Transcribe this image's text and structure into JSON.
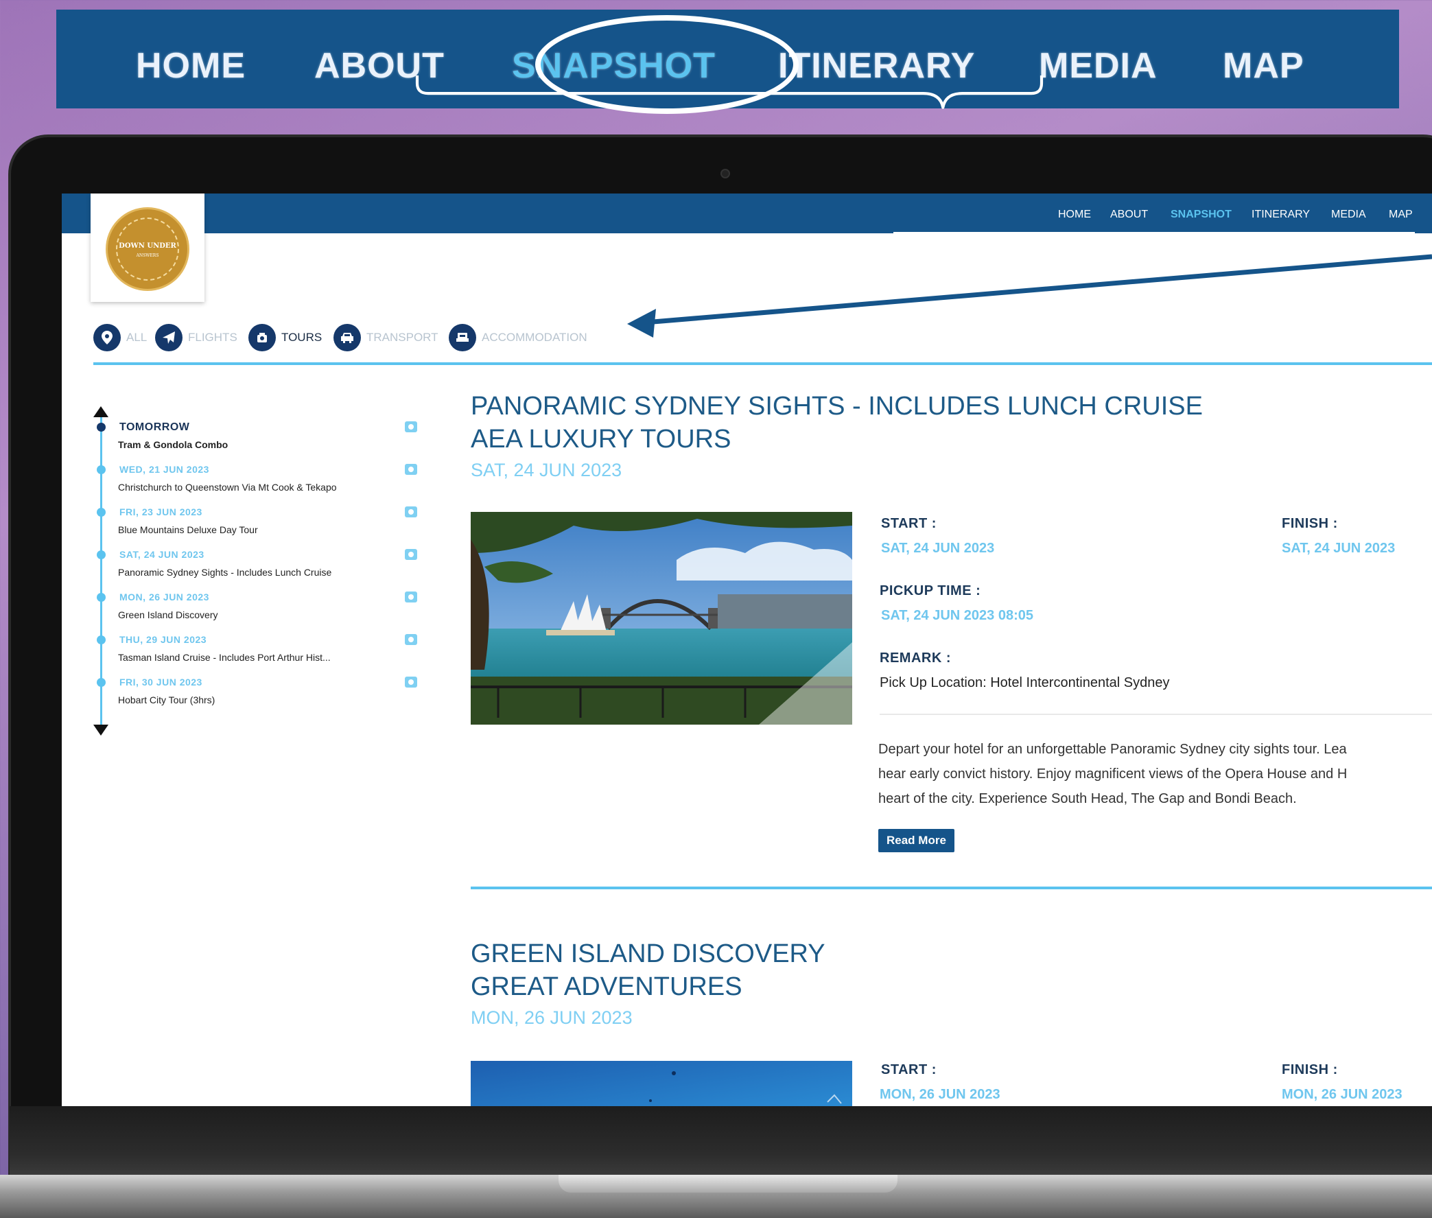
{
  "promo_nav": {
    "items": [
      {
        "label": "HOME"
      },
      {
        "label": "ABOUT"
      },
      {
        "label": "SNAPSHOT"
      },
      {
        "label": "ITINERARY"
      },
      {
        "label": "MEDIA"
      },
      {
        "label": "MAP"
      }
    ],
    "active_index": 2
  },
  "site_nav": {
    "items": [
      {
        "label": "HOME"
      },
      {
        "label": "ABOUT"
      },
      {
        "label": "SNAPSHOT"
      },
      {
        "label": "ITINERARY"
      },
      {
        "label": "MEDIA"
      },
      {
        "label": "MAP"
      }
    ],
    "active_index": 2
  },
  "logo": {
    "text": "DOWN UNDER",
    "sub": "ANSWERS"
  },
  "filters": [
    {
      "label": "ALL",
      "icon": "map-pin-icon",
      "active": false
    },
    {
      "label": "FLIGHTS",
      "icon": "plane-icon",
      "active": false
    },
    {
      "label": "TOURS",
      "icon": "tours-icon",
      "active": true
    },
    {
      "label": "TRANSPORT",
      "icon": "car-icon",
      "active": false
    },
    {
      "label": "ACCOMMODATION",
      "icon": "bed-icon",
      "active": false
    }
  ],
  "timeline": [
    {
      "date": "TOMORROW",
      "title": "Tram & Gondola Combo",
      "current": true
    },
    {
      "date": "WED, 21 JUN 2023",
      "title": "Christchurch to Queenstown Via Mt Cook & Tekapo",
      "current": false
    },
    {
      "date": "FRI, 23 JUN 2023",
      "title": "Blue Mountains Deluxe Day Tour",
      "current": false
    },
    {
      "date": "SAT, 24 JUN 2023",
      "title": "Panoramic Sydney Sights - Includes Lunch Cruise",
      "current": false
    },
    {
      "date": "MON, 26 JUN 2023",
      "title": "Green Island Discovery",
      "current": false
    },
    {
      "date": "THU, 29 JUN 2023",
      "title": "Tasman Island Cruise - Includes Port Arthur Hist...",
      "current": false
    },
    {
      "date": "FRI, 30 JUN 2023",
      "title": "Hobart City Tour (3hrs)",
      "current": false
    }
  ],
  "tours": [
    {
      "title": "PANORAMIC SYDNEY SIGHTS - INCLUDES LUNCH CRUISE",
      "operator": "AEA LUXURY TOURS",
      "date": "SAT, 24 JUN 2023",
      "start_label": "START :",
      "start_value": "SAT, 24 JUN 2023",
      "finish_label": "FINISH :",
      "finish_value": "SAT, 24 JUN 2023",
      "pickup_label": "PICKUP TIME :",
      "pickup_value": "SAT, 24 JUN 2023 08:05",
      "remark_label": "REMARK :",
      "remark_value": "Pick Up Location: Hotel Intercontinental Sydney",
      "description": [
        "Depart your hotel for an unforgettable Panoramic Sydney city sights tour. Lea",
        "hear early convict history. Enjoy magnificent views of the Opera House and H",
        "heart of the city. Experience South Head, The Gap and Bondi Beach."
      ],
      "read_more": "Read More"
    },
    {
      "title": "GREEN ISLAND DISCOVERY",
      "operator": "GREAT ADVENTURES",
      "date": "MON, 26 JUN 2023",
      "start_label": "START :",
      "start_value": "MON, 26 JUN 2023",
      "finish_label": "FINISH :",
      "finish_value": "MON, 26 JUN 2023"
    }
  ],
  "colors": {
    "brand_blue": "#15548a",
    "accent_cyan": "#5bc3ef",
    "dark_navy": "#15386a",
    "gold": "#c4902e"
  }
}
